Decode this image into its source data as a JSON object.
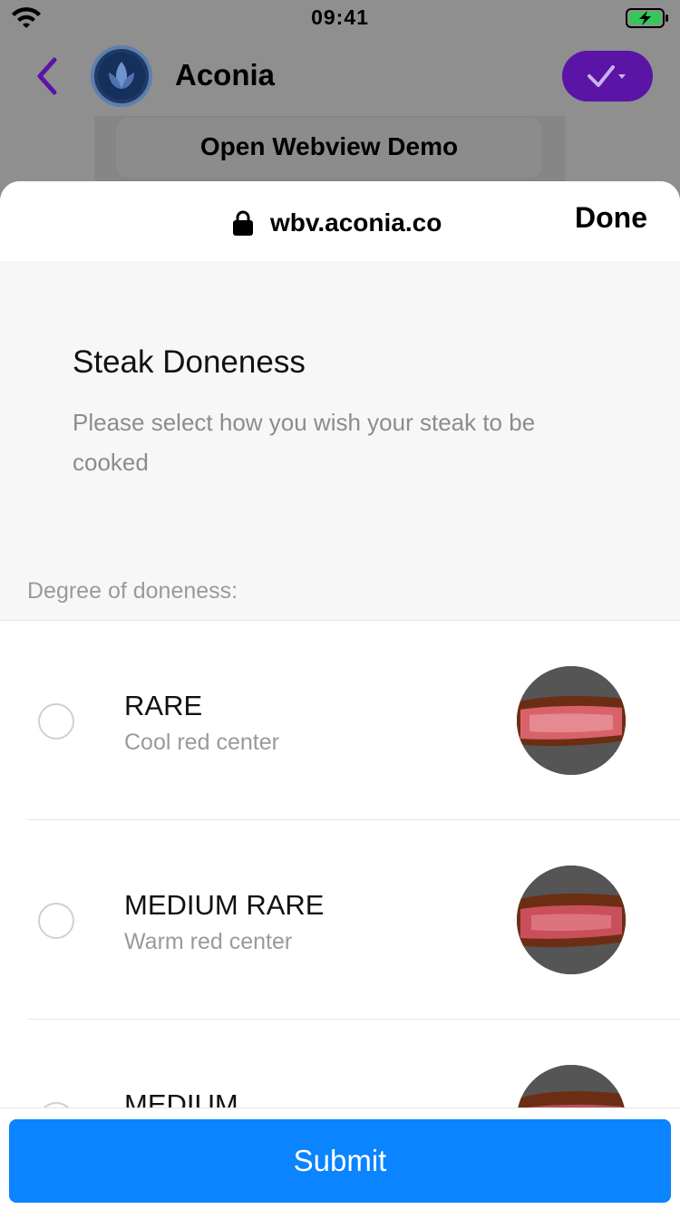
{
  "status_bar": {
    "time": "09:41"
  },
  "app_header": {
    "title": "Aconia"
  },
  "background_button": {
    "label": "Open Webview Demo"
  },
  "webview": {
    "url": "wbv.aconia.co",
    "done_label": "Done"
  },
  "form": {
    "title": "Steak Doneness",
    "description": "Please select how you wish your steak to be cooked",
    "field_label": "Degree of doneness:"
  },
  "options": [
    {
      "title": "RARE",
      "subtitle": "Cool red center",
      "selected": false
    },
    {
      "title": "MEDIUM RARE",
      "subtitle": "Warm red center",
      "selected": false
    },
    {
      "title": "MEDIUM",
      "subtitle": "",
      "selected": false
    }
  ],
  "submit": {
    "label": "Submit"
  },
  "colors": {
    "accent_purple": "#5a14a6",
    "submit_blue": "#0a84ff",
    "battery_green": "#34c759"
  }
}
